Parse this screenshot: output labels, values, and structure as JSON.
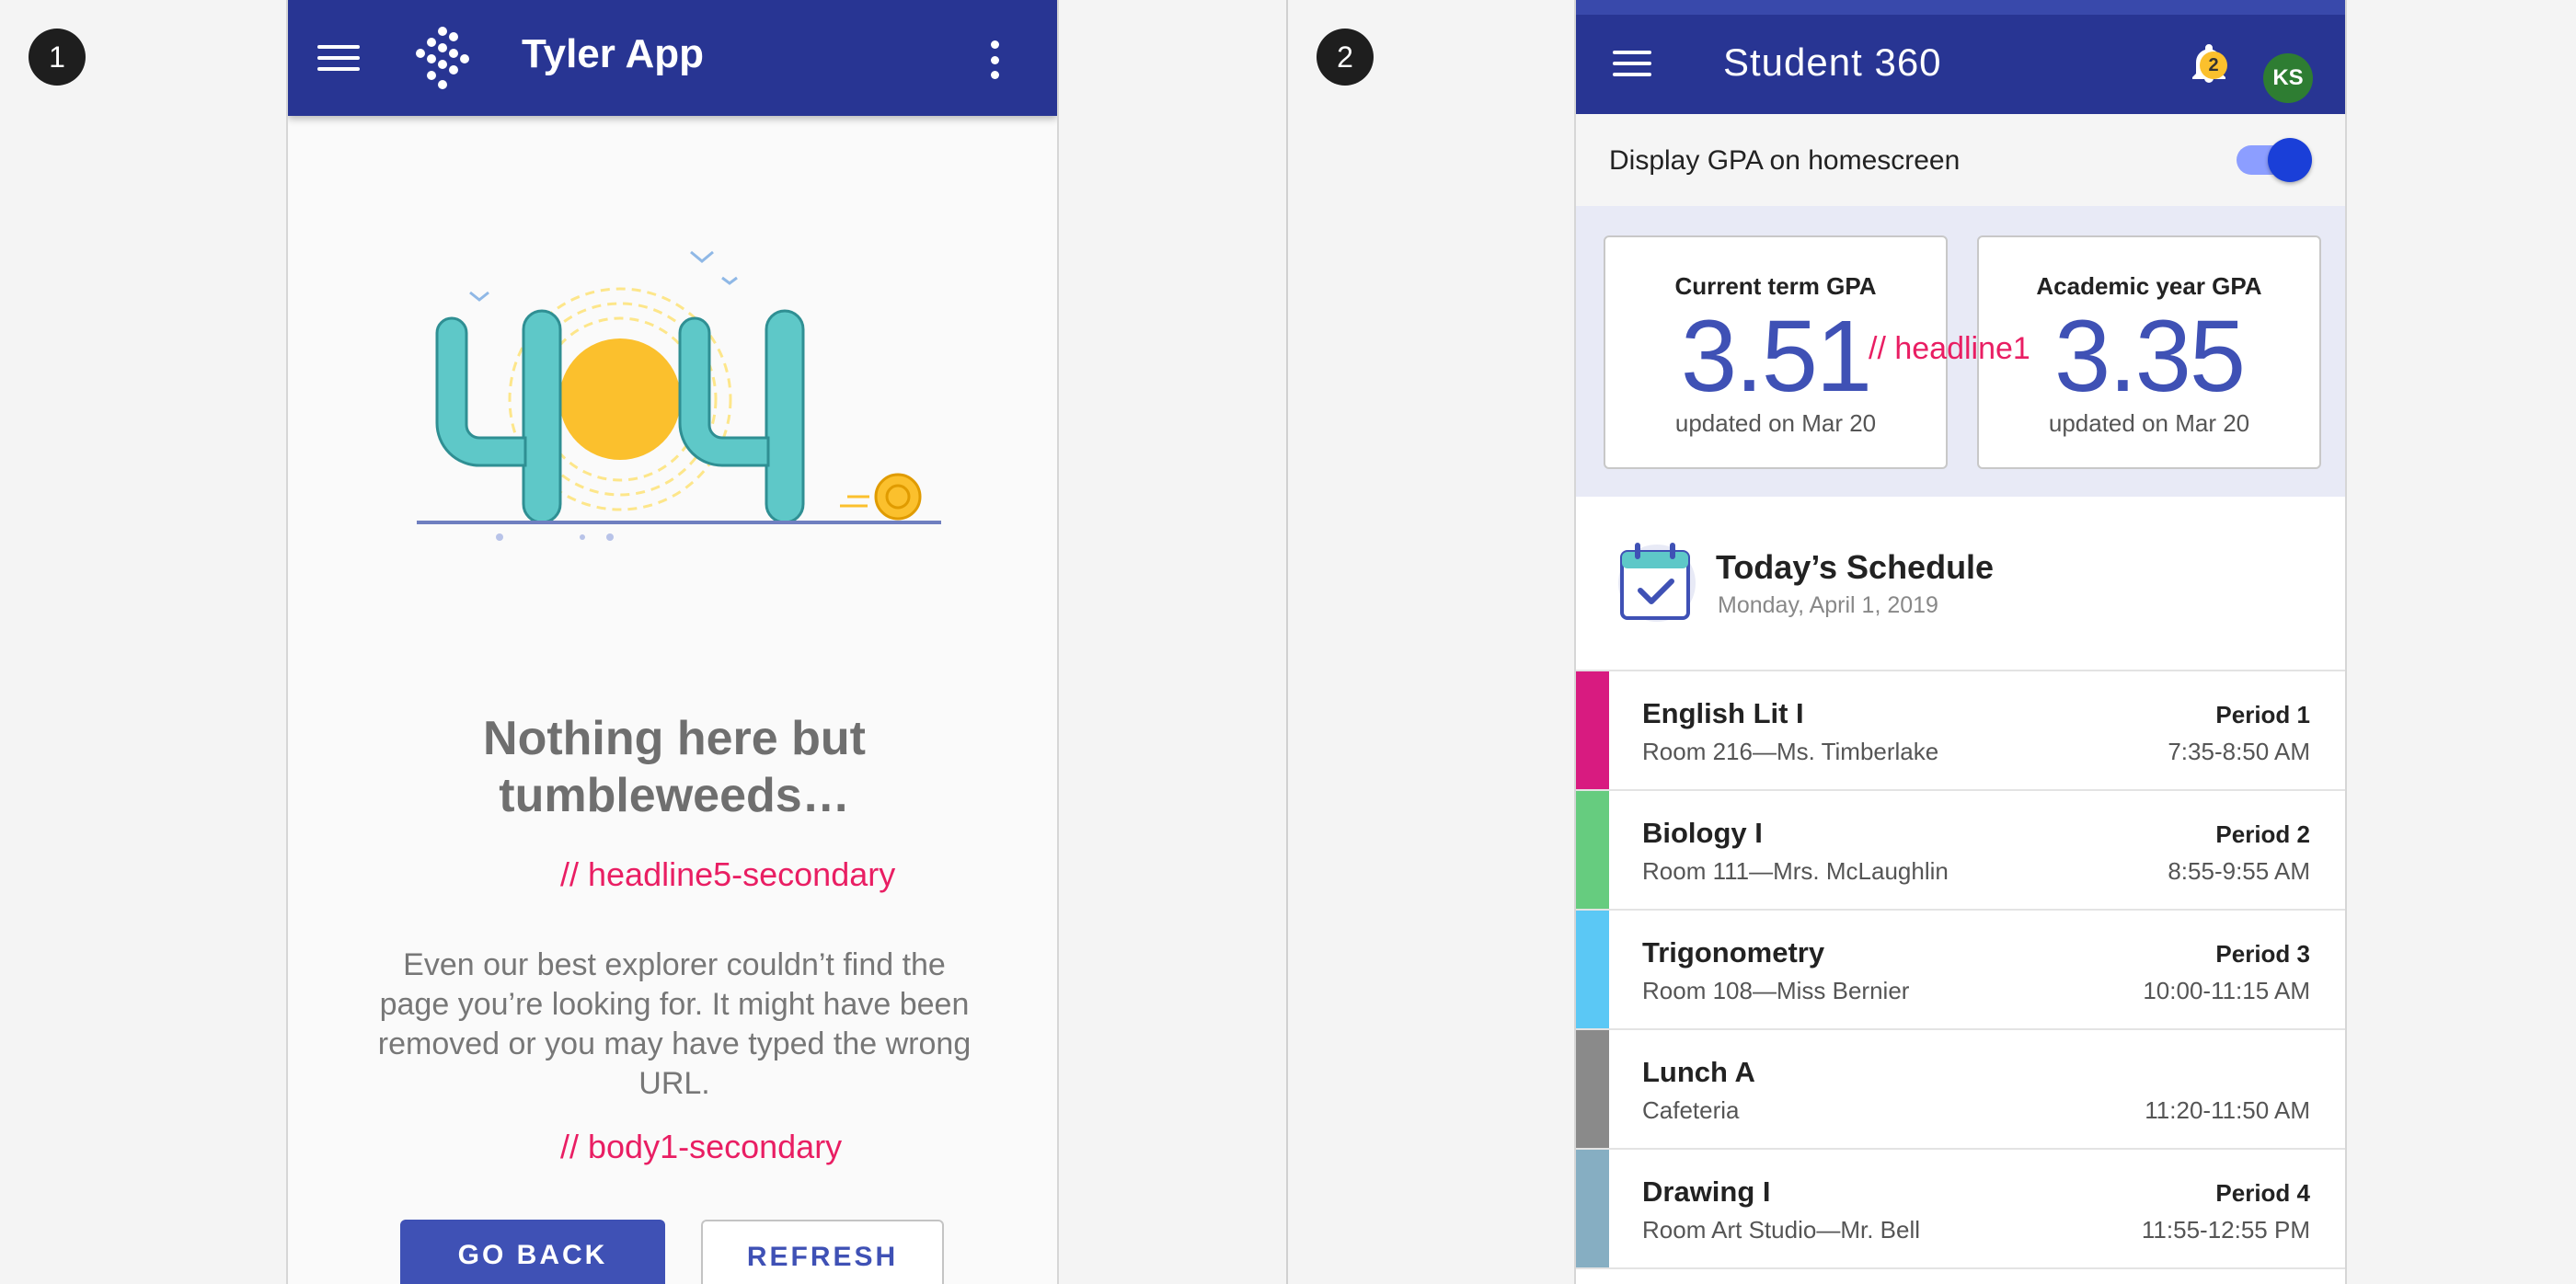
{
  "steps": [
    "1",
    "2"
  ],
  "screen1": {
    "app_title": "Tyler App",
    "headline": "Nothing here but tumbleweeds…",
    "headline_note": "// headline5-secondary",
    "body": "Even our best explorer couldn’t find the page you’re looking for. It might have been removed or you may have typed the wrong URL.",
    "body_note": "// body1-secondary",
    "primary_button": "GO BACK",
    "secondary_button": "REFRESH",
    "colors": {
      "appbar": "#283593",
      "primary": "#3f51b5",
      "annotation": "#e91e63"
    }
  },
  "screen2": {
    "app_title": "Student 360",
    "notification_count": "2",
    "avatar_initials": "KS",
    "toggle_label": "Display GPA on homescreen",
    "toggle_on": true,
    "gpa": [
      {
        "label": "Current term GPA",
        "value": "3.51",
        "updated": "updated on Mar 20"
      },
      {
        "label": "Academic year GPA",
        "value": "3.35",
        "updated": "updated on Mar 20"
      }
    ],
    "gpa_note": "// headline1",
    "schedule_title": "Today’s Schedule",
    "schedule_date": "Monday, April 1, 2019",
    "classes": [
      {
        "name": "English Lit I",
        "room": "Room 216—Ms. Timberlake",
        "period": "Period 1",
        "time": "7:35-8:50 AM",
        "color": "#d81b80"
      },
      {
        "name": "Biology I",
        "room": "Room 111—Mrs. McLaughlin",
        "period": "Period 2",
        "time": "8:55-9:55 AM",
        "color": "#66cc7f"
      },
      {
        "name": "Trigonometry",
        "room": "Room 108—Miss Bernier",
        "period": "Period 3",
        "time": "10:00-11:15 AM",
        "color": "#5bc8f5"
      },
      {
        "name": "Lunch A",
        "room": "Cafeteria",
        "period": "",
        "time": "11:20-11:50 AM",
        "color": "#8a8a8a"
      },
      {
        "name": "Drawing I",
        "room": "Room Art Studio—Mr. Bell",
        "period": "Period 4",
        "time": "11:55-12:55 PM",
        "color": "#86aec2"
      }
    ],
    "colors": {
      "appbar": "#283593",
      "gpa_value": "#3f51b5",
      "badge": "#fbc02d",
      "avatar": "#2e7d32"
    }
  }
}
